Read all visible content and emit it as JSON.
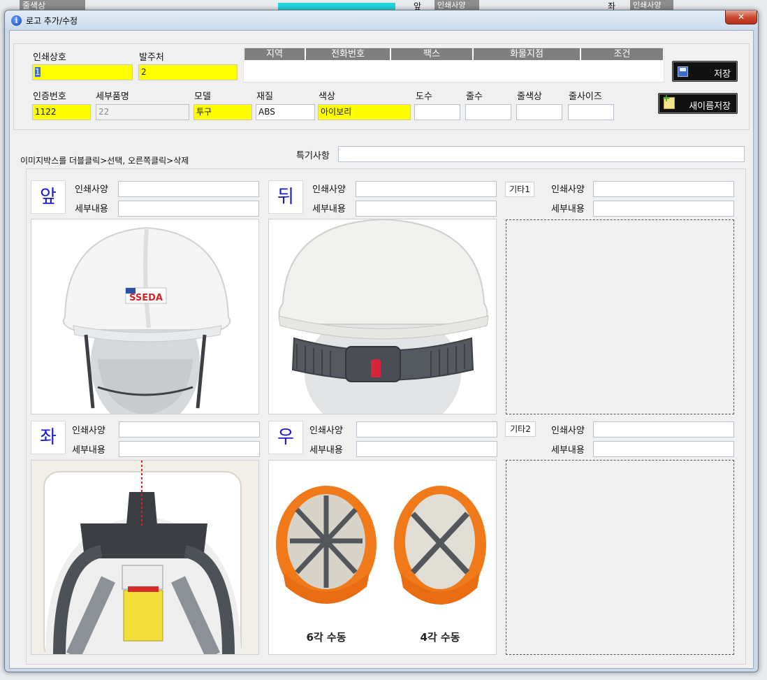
{
  "background": {
    "strip1": "줄색상",
    "strip2": "인쇄사양",
    "strip3": "인쇄사양",
    "front_label": "앞",
    "left_label": "좌"
  },
  "dialog": {
    "title": "로고 추가/수정",
    "close": "✕"
  },
  "form": {
    "print_company_label": "인쇄상호",
    "print_company_value": "1",
    "orderer_label": "발주처",
    "orderer_value": "2",
    "grid_headers": [
      "지역",
      "전화번호",
      "팩스",
      "화물지점",
      "조건"
    ],
    "cert_no_label": "인증번호",
    "cert_no_value": "1122",
    "detail_item_label": "세부품명",
    "detail_item_value": "22",
    "model_label": "모델",
    "model_value": "투구",
    "material_label": "재질",
    "material_value": "ABS",
    "color_label": "색상",
    "color_value": "아이보리",
    "degree_label": "도수",
    "degree_value": "",
    "lines_label": "줄수",
    "lines_value": "",
    "line_color_label": "줄색상",
    "line_color_value": "",
    "line_size_label": "줄사이즈",
    "line_size_value": "",
    "save_label": "저장",
    "save_as_label": "새이름저장",
    "hint": "이미지박스를 더블클릭>선택, 오른쪽클릭>삭제",
    "notes_label": "특기사항",
    "notes_value": ""
  },
  "panels": {
    "front": {
      "tag": "앞",
      "spec_label": "인쇄사양",
      "detail_label": "세부내용"
    },
    "back": {
      "tag": "뒤",
      "spec_label": "인쇄사양",
      "detail_label": "세부내용"
    },
    "etc1": {
      "tag": "기타1",
      "spec_label": "인쇄사양",
      "detail_label": "세부내용"
    },
    "left": {
      "tag": "좌",
      "spec_label": "인쇄사양",
      "detail_label": "세부내용"
    },
    "right": {
      "tag": "우",
      "spec_label": "인쇄사양",
      "detail_label": "세부내용",
      "caption_a": "6각 수동",
      "caption_b": "4각 수동"
    },
    "etc2": {
      "tag": "기타2",
      "spec_label": "인쇄사양",
      "detail_label": "세부내용"
    }
  },
  "brand_logo_text": "SSEDA",
  "colors": {
    "required_field": "#ffff00",
    "helmet_white": "#f4f4f4",
    "helmet_orange": "#f07a1a",
    "strap_gray": "#555a60"
  }
}
